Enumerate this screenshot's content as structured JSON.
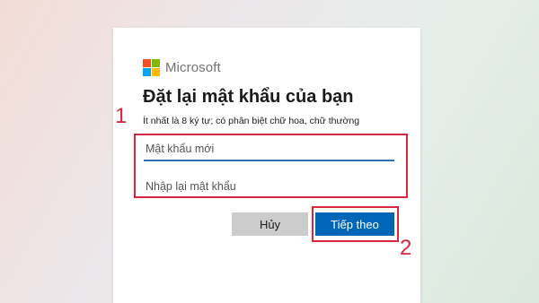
{
  "brand": {
    "name": "Microsoft",
    "logo_colors": [
      "#f25022",
      "#7fba00",
      "#00a4ef",
      "#ffb900"
    ]
  },
  "form": {
    "title": "Đặt lại mật khẩu của bạn",
    "hint": "Ít nhất là 8 ký tự; có phân biệt chữ hoa, chữ thường",
    "new_password": {
      "placeholder": "Mật khẩu mới",
      "value": ""
    },
    "confirm_password": {
      "placeholder": "Nhập lại mật khẩu",
      "value": ""
    },
    "cancel_label": "Hủy",
    "next_label": "Tiếp theo"
  },
  "annotations": {
    "step_1": "1",
    "step_2": "2",
    "highlight_color": "#d7263d"
  },
  "colors": {
    "primary": "#0067b8",
    "secondary_button": "#cccccc"
  }
}
